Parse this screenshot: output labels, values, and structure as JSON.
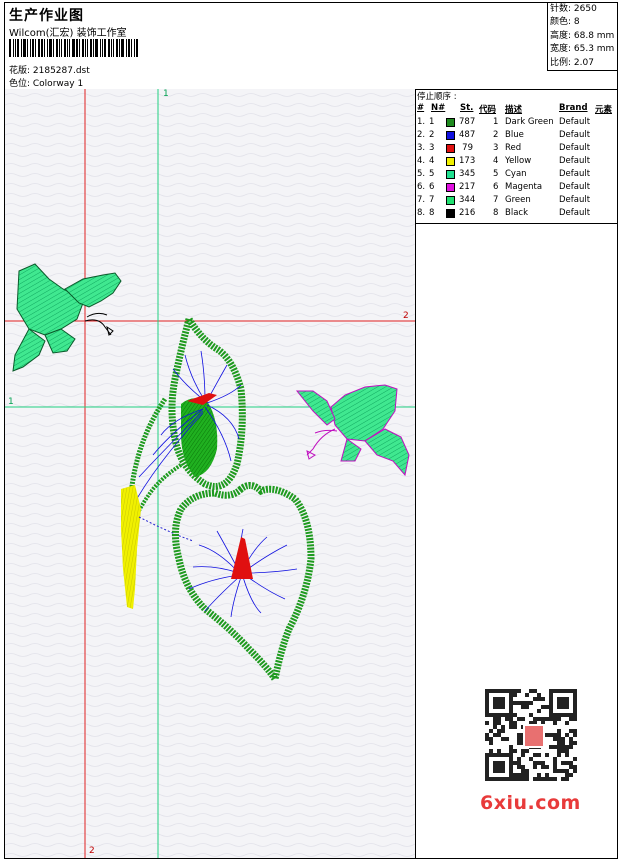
{
  "header": {
    "title": "生产作业图",
    "subtitle": "Wilcom(汇宏) 装饰工作室",
    "file_label": "花版: 2185287.dst",
    "colorway_label": "色位:  Colorway 1"
  },
  "stats": {
    "stitches": "针数: 2650",
    "colors": "颜色: 8",
    "height": "高度: 68.8 mm",
    "width": "宽度: 65.3 mm",
    "scale": "比例: 2.07"
  },
  "guides": {
    "red_top": "2",
    "red_bottom": "2",
    "green_top": "1",
    "green_left": "1"
  },
  "stop_sequence": {
    "title": "停止顺序 :",
    "columns": [
      "#",
      "N#",
      "St.",
      "代码",
      "描述",
      "Brand",
      "元素"
    ],
    "rows": [
      {
        "idx": "1.",
        "n": "1",
        "st": "787",
        "code": "1",
        "desc": "Dark Green",
        "brand": "Default",
        "color": "#1e8a1e"
      },
      {
        "idx": "2.",
        "n": "2",
        "st": "487",
        "code": "2",
        "desc": "Blue",
        "brand": "Default",
        "color": "#1010e0"
      },
      {
        "idx": "3.",
        "n": "3",
        "st": "79",
        "code": "3",
        "desc": "Red",
        "brand": "Default",
        "color": "#e01010"
      },
      {
        "idx": "4.",
        "n": "4",
        "st": "173",
        "code": "4",
        "desc": "Yellow",
        "brand": "Default",
        "color": "#f0f000"
      },
      {
        "idx": "5.",
        "n": "5",
        "st": "345",
        "code": "5",
        "desc": "Cyan",
        "brand": "Default",
        "color": "#20e090"
      },
      {
        "idx": "6.",
        "n": "6",
        "st": "217",
        "code": "6",
        "desc": "Magenta",
        "brand": "Default",
        "color": "#e010e0"
      },
      {
        "idx": "7.",
        "n": "7",
        "st": "344",
        "code": "7",
        "desc": "Green",
        "brand": "Default",
        "color": "#20e070"
      },
      {
        "idx": "8.",
        "n": "8",
        "st": "216",
        "code": "8",
        "desc": "Black",
        "brand": "Default",
        "color": "#000000"
      }
    ]
  },
  "watermark": {
    "qr_icon": "qr-code-icon",
    "site": "6xiu.com"
  }
}
